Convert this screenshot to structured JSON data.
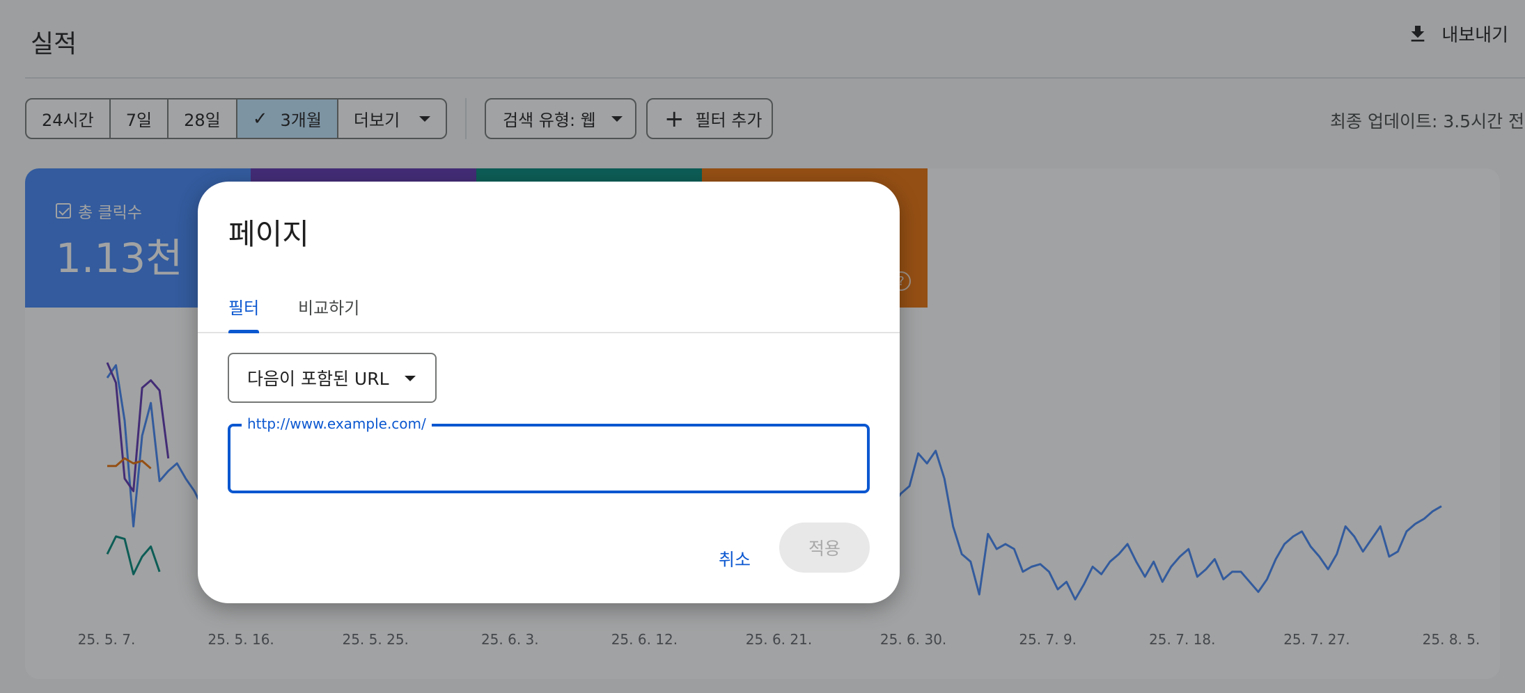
{
  "page": {
    "title": "실적",
    "export_label": "내보내기",
    "date_ranges": [
      "24시간",
      "7일",
      "28일",
      "3개월"
    ],
    "selected_range": "3개월",
    "more_label": "더보기",
    "search_type_label": "검색 유형: 웹",
    "add_filter_label": "필터 추가",
    "last_update": "최종 업데이트: 3.5시간 전"
  },
  "metrics": {
    "clicks_label": "총 클릭수",
    "clicks_value": "1.13천"
  },
  "colors": {
    "clicks": "#4285f4",
    "impressions": "#5e35b1",
    "ctr": "#00897b",
    "position": "#e8710a",
    "accent": "#0b57d0"
  },
  "chart_data": {
    "type": "line",
    "x_tick_labels": [
      "25. 5. 7.",
      "25. 5. 16.",
      "25. 5. 25.",
      "25. 6. 3.",
      "25. 6. 12.",
      "25. 6. 21.",
      "25. 6. 30.",
      "25. 7. 9.",
      "25. 7. 18.",
      "25. 7. 27.",
      "25. 8. 5."
    ],
    "grid": false,
    "legend": "none",
    "series": [
      {
        "color": "#4285f4",
        "values": [
          0.92,
          0.97,
          0.75,
          0.33,
          0.69,
          0.82,
          0.51,
          0.55,
          0.58,
          0.52,
          0.47,
          0.4,
          0.42,
          0.36,
          0.34,
          0.3,
          0.27,
          0.24,
          0.22,
          0.18,
          0.21,
          0.15,
          0.18,
          0.22,
          0.2,
          0.25,
          0.27,
          0.3,
          0.33,
          0.38,
          0.44,
          0.52,
          0.45,
          0.42,
          0.5,
          0.62,
          0.47,
          0.56,
          0.63,
          0.54,
          0.61,
          0.72,
          0.81,
          0.93,
          0.82,
          0.75,
          0.66,
          0.68,
          0.61,
          0.53,
          0.6,
          0.69,
          0.58,
          0.67,
          0.76,
          0.5,
          0.47,
          0.67,
          0.61,
          0.72,
          0.63,
          0.52,
          0.6,
          0.67,
          0.61,
          0.7,
          0.79,
          0.72,
          0.46,
          0.49,
          0.71,
          0.8,
          0.62,
          0.55,
          0.52,
          0.54,
          0.52,
          0.23,
          0.22,
          0.17,
          0.19,
          0.16,
          0.14,
          0.18,
          0.25,
          0.34,
          0.38,
          0.41,
          0.32,
          0.36,
          0.41,
          0.46,
          0.49,
          0.62,
          0.58,
          0.63,
          0.52,
          0.33,
          0.22,
          0.19,
          0.06,
          0.3,
          0.24,
          0.26,
          0.24,
          0.15,
          0.17,
          0.18,
          0.15,
          0.08,
          0.11,
          0.04,
          0.1,
          0.17,
          0.14,
          0.19,
          0.22,
          0.26,
          0.19,
          0.13,
          0.19,
          0.11,
          0.17,
          0.21,
          0.24,
          0.13,
          0.16,
          0.2,
          0.12,
          0.15,
          0.15,
          0.11,
          0.07,
          0.12,
          0.2,
          0.26,
          0.29,
          0.31,
          0.25,
          0.21,
          0.16,
          0.22,
          0.33,
          0.29,
          0.23,
          0.28,
          0.33,
          0.21,
          0.23,
          0.31,
          0.34,
          0.36,
          0.39,
          0.41
        ]
      },
      {
        "color": "#5e35b1",
        "values": [
          0.98,
          0.9,
          0.52,
          0.47,
          0.88,
          0.91,
          0.87,
          0.6
        ]
      },
      {
        "color": "#00897b",
        "values": [
          0.22,
          0.29,
          0.28,
          0.14,
          0.21,
          0.25,
          0.15
        ]
      },
      {
        "color": "#e8710a",
        "values": [
          0.57,
          0.57,
          0.6,
          0.58,
          0.59,
          0.56
        ]
      }
    ]
  },
  "dialog": {
    "title": "페이지",
    "tabs": [
      "필터",
      "비교하기"
    ],
    "active_tab": "필터",
    "select_value": "다음이 포함된 URL",
    "url_label": "http://www.example.com/",
    "url_value": "",
    "cancel_label": "취소",
    "apply_label": "적용"
  }
}
